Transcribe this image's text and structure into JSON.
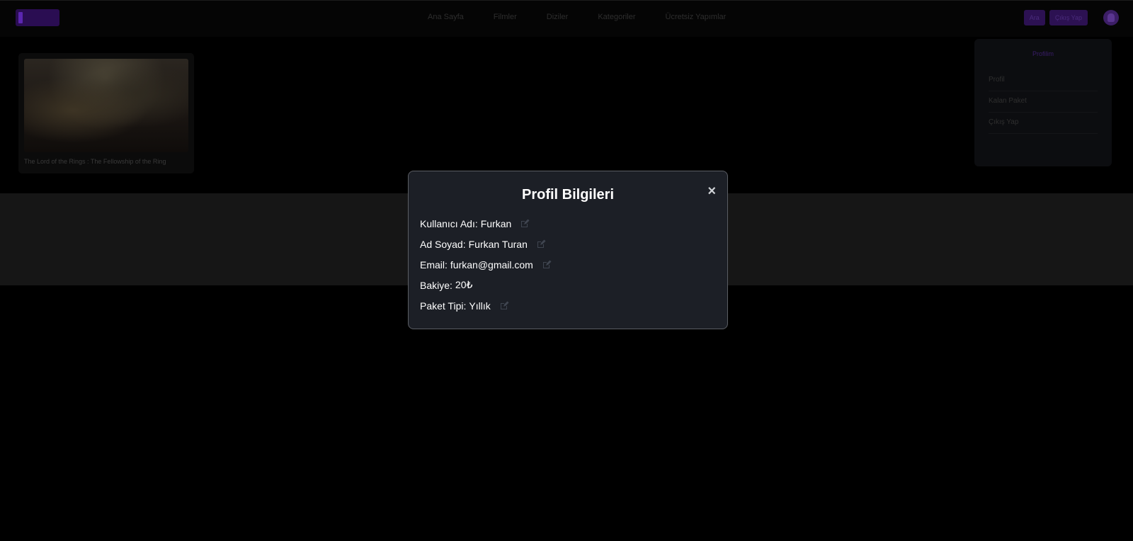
{
  "nav": {
    "items": [
      "Ana Sayfa",
      "Filmler",
      "Diziler",
      "Kategoriler",
      "Ücretsiz Yapımlar"
    ]
  },
  "top_actions": {
    "button_1": "Ara",
    "button_2": "Çıkış Yap"
  },
  "movie": {
    "title": "The Lord of the Rings : The Fellowship of the Ring"
  },
  "sidebar": {
    "title": "Profilim",
    "items": [
      "Profil",
      "Kalan Paket",
      "Çıkış Yap"
    ]
  },
  "modal": {
    "title": "Profil Bilgileri",
    "close_glyph": "×",
    "rows": [
      {
        "label": "Kullanıcı Adı:",
        "value": "Furkan",
        "editable": true
      },
      {
        "label": "Ad Soyad:",
        "value": "Furkan Turan",
        "editable": true
      },
      {
        "label": "Email:",
        "value": "furkan@gmail.com",
        "editable": true
      },
      {
        "label": "Bakiye:",
        "value": "20₺",
        "editable": false
      },
      {
        "label": "Paket Tipi:",
        "value": "Yıllık",
        "editable": true
      }
    ]
  },
  "colors": {
    "page_bg": "#000000",
    "modal_bg": "#1c1f26",
    "accent_purple": "#2c1152",
    "edit_icon": "#3f4550"
  },
  "icons": {
    "edit": "edit-icon",
    "close": "close-icon",
    "avatar": "user-avatar-icon"
  }
}
